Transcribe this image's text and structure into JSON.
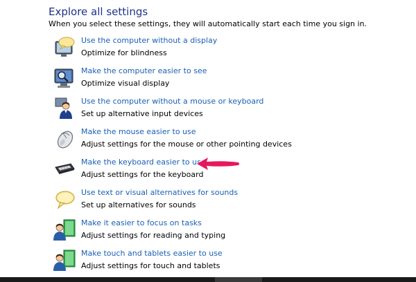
{
  "section": {
    "title": "Explore all settings",
    "intro": "When you select these settings, they will automatically start each time you sign in."
  },
  "items": [
    {
      "link": "Use the computer without a display",
      "desc": "Optimize for blindness",
      "icon": "speech-bubble-monitor-icon"
    },
    {
      "link": "Make the computer easier to see",
      "desc": "Optimize visual display",
      "icon": "magnifier-monitor-icon"
    },
    {
      "link": "Use the computer without a mouse or keyboard",
      "desc": "Set up alternative input devices",
      "icon": "person-icon"
    },
    {
      "link": "Make the mouse easier to use",
      "desc": "Adjust settings for the mouse or other pointing devices",
      "icon": "mouse-icon"
    },
    {
      "link": "Make the keyboard easier to use",
      "desc": "Adjust settings for the keyboard",
      "icon": "keyboard-icon"
    },
    {
      "link": "Use text or visual alternatives for sounds",
      "desc": "Set up alternatives for sounds",
      "icon": "speech-bubble-icon"
    },
    {
      "link": "Make it easier to focus on tasks",
      "desc": "Adjust settings for reading and typing",
      "icon": "person-document-icon"
    },
    {
      "link": "Make touch and tablets easier to use",
      "desc": "Adjust settings for touch and tablets",
      "icon": "person-tablet-icon"
    }
  ],
  "colors": {
    "title": "#1e3287",
    "link": "#1a5fb4",
    "arrow": "#e8175d"
  }
}
